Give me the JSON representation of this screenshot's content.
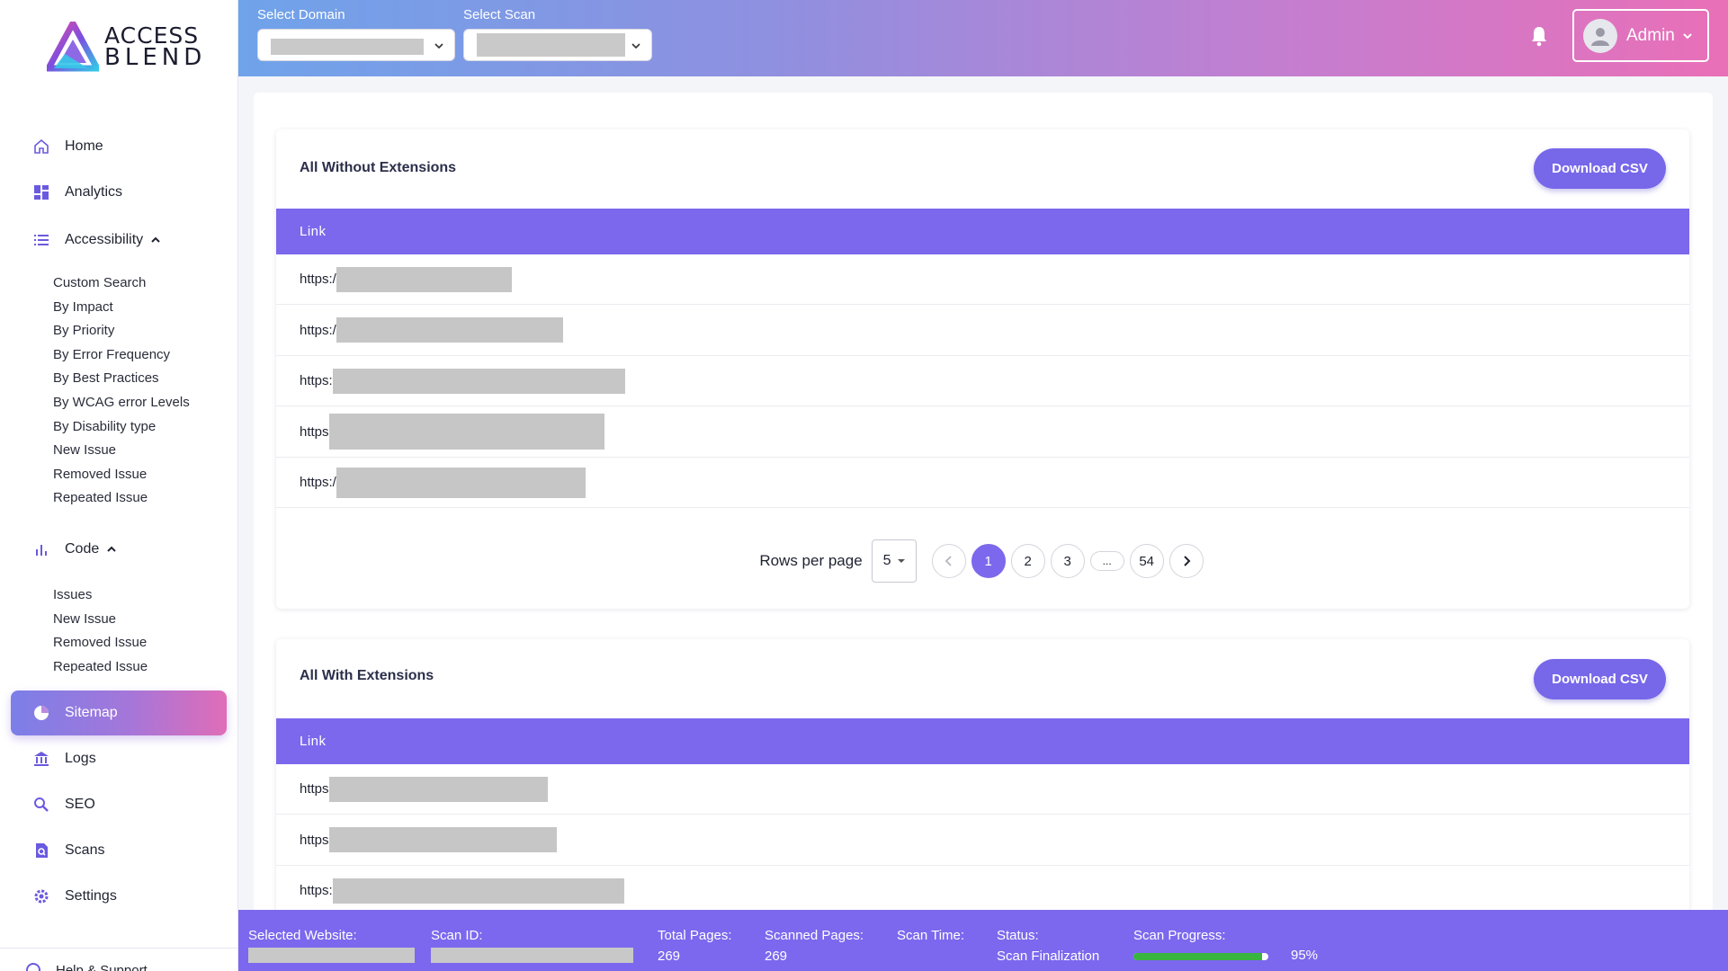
{
  "brand": {
    "line1": "ACCESS",
    "line2": "BLEND"
  },
  "sidebar": {
    "home": "Home",
    "analytics": "Analytics",
    "accessibility": "Accessibility",
    "accessibility_items": [
      "Custom Search",
      "By Impact",
      "By Priority",
      "By Error Frequency",
      "By Best Practices",
      "By WCAG error Levels",
      "By Disability type",
      "New Issue",
      "Removed Issue",
      "Repeated Issue"
    ],
    "code": "Code",
    "code_items": [
      "Issues",
      "New Issue",
      "Removed Issue",
      "Repeated Issue"
    ],
    "sitemap": "Sitemap",
    "logs": "Logs",
    "seo": "SEO",
    "scans": "Scans",
    "settings": "Settings",
    "help": "Help & Support"
  },
  "header": {
    "domain_label": "Select Domain",
    "scan_label": "Select Scan",
    "user": "Admin"
  },
  "cards": [
    {
      "title": "All Without Extensions",
      "download": "Download CSV",
      "column": "Link",
      "rows": [
        "https:/",
        "https:/",
        "https:",
        "https",
        "https:/"
      ]
    },
    {
      "title": "All With Extensions",
      "download": "Download CSV",
      "column": "Link",
      "rows": [
        "https",
        "https",
        "https:"
      ]
    }
  ],
  "pagination": {
    "rows_per_page_label": "Rows per page",
    "rows_per_page": "5",
    "pages": [
      "1",
      "2",
      "3",
      "...",
      "54"
    ],
    "current": "1"
  },
  "footer": {
    "selected_website_label": "Selected Website:",
    "scan_id_label": "Scan ID:",
    "total_pages_label": "Total Pages:",
    "total_pages": "269",
    "scanned_pages_label": "Scanned Pages:",
    "scanned_pages": "269",
    "scan_time_label": "Scan Time:",
    "status_label": "Status:",
    "status": "Scan Finalization",
    "progress_label": "Scan Progress:",
    "progress_value": 0.95,
    "progress_text": "95%"
  },
  "colors": {
    "accent": "#7b68ed",
    "progress": "#39b43e"
  }
}
